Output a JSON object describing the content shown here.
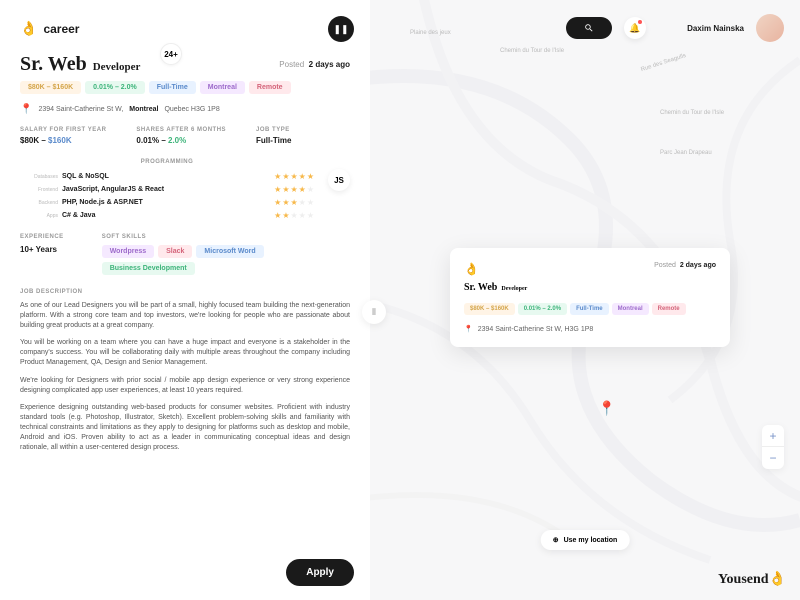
{
  "logo": {
    "text": "career"
  },
  "job": {
    "title_main": "Sr. Web",
    "title_sub": "Developer",
    "badge": "24+",
    "posted_label": "Posted",
    "posted_value": "2 days ago",
    "tags": {
      "salary": "$80K – $160K",
      "shares": "0.01% – 2.0%",
      "time": "Full-Time",
      "location": "Montreal",
      "remote": "Remote"
    },
    "address": {
      "street": "2394 Saint-Catherine St W,",
      "city": "Montreal",
      "rest": "Quebec H3G 1P8"
    },
    "info": {
      "salary_label": "SALARY FOR FIRST YEAR",
      "salary_low": "$80K –",
      "salary_high": "$160K",
      "shares_label": "SHARES AFTER 6 MONTHS",
      "shares_low": "0.01% –",
      "shares_high": "2.0%",
      "type_label": "JOB TYPE",
      "type_value": "Full-Time"
    },
    "skills_header": "PROGRAMMING",
    "skills": [
      {
        "cat": "Databases",
        "name": "SQL & NoSQL",
        "rating": 5
      },
      {
        "cat": "Frontend",
        "name": "JavaScript, AngularJS & React",
        "rating": 4
      },
      {
        "cat": "Backend",
        "name": "PHP, Node.js & ASP.NET",
        "rating": 3
      },
      {
        "cat": "Apps",
        "name": "C# & Java",
        "rating": 2
      }
    ],
    "js_badge": "JS",
    "exp_label": "EXPERIENCE",
    "exp_value": "10+ Years",
    "soft_label": "SOFT SKILLS",
    "soft": {
      "wp": "Wordpress",
      "slack": "Slack",
      "word": "Microsoft Word",
      "biz": "Business Development"
    },
    "desc_label": "JOB DESCRIPTION",
    "desc": [
      "As one of our Lead Designers you will be part of a small, highly focused team building the next-generation platform. With a strong core team and top investors, we're looking for people who are passionate about building great products at a great company.",
      "You will be working on a team where you can have a huge impact and everyone is a stakeholder in the company's success. You will be collaborating daily with multiple areas throughout the company including Product Management, QA, Design and Senior Management.",
      "We're looking for Designers with prior social / mobile app design experience or very strong experience designing complicated app user experiences, at least 10 years required.",
      "Experience designing outstanding web-based products for consumer websites. Proficient with industry standard tools (e.g. Photoshop, Illustrator, Sketch). Excellent problem-solving skills and familiarity with technical constraints and limitations as they apply to designing for platforms such as desktop and mobile, Android and iOS. Proven ability to act as a leader in communicating conceptual ideas and design rationale, all within a user-centered design process."
    ],
    "apply": "Apply"
  },
  "topbar": {
    "user": "Daxim Nainska"
  },
  "card": {
    "posted_label": "Posted",
    "posted_value": "2 days ago",
    "title_main": "Sr. Web",
    "title_sub": "Developer",
    "address": "2394 Saint-Catherine St W, H3G 1P8"
  },
  "map": {
    "locate": "Use my location",
    "brand": "Yousend",
    "labels": {
      "plaine": "Plaine des jeux",
      "parc": "Parc Jean Drapeau",
      "rue": "Rue des Seagulls",
      "chemin1": "Chemin du Tour de l'Isle",
      "chemin2": "Chemin du Tour de l'Isle"
    },
    "zoom_in": "+",
    "zoom_out": "−"
  }
}
